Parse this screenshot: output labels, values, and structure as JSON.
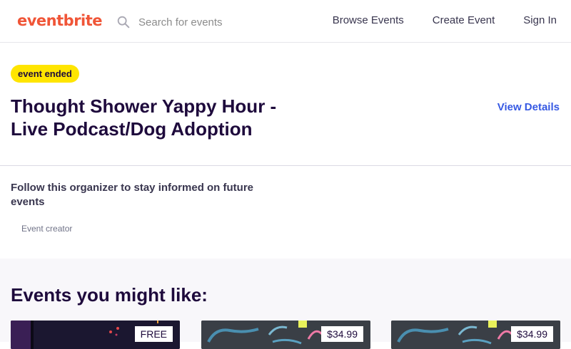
{
  "header": {
    "logo": "eventbrite",
    "search_placeholder": "Search for events",
    "nav": [
      "Browse Events",
      "Create Event",
      "Sign In"
    ]
  },
  "event": {
    "status_badge": "event ended",
    "title": "Thought Shower Yappy Hour - Live Podcast/Dog Adoption",
    "view_details": "View Details"
  },
  "organizer": {
    "follow_text": "Follow this organizer to stay informed on future events",
    "creator_label": "Event creator"
  },
  "suggestions": {
    "title": "Events you might like:",
    "cards": [
      {
        "price": "FREE"
      },
      {
        "price": "$34.99"
      },
      {
        "price": "$34.99"
      }
    ]
  },
  "colors": {
    "brand": "#f05537",
    "link": "#3659e3",
    "badge": "#ffe500",
    "heading": "#1e0a3c"
  },
  "icons": [
    "search-icon"
  ]
}
